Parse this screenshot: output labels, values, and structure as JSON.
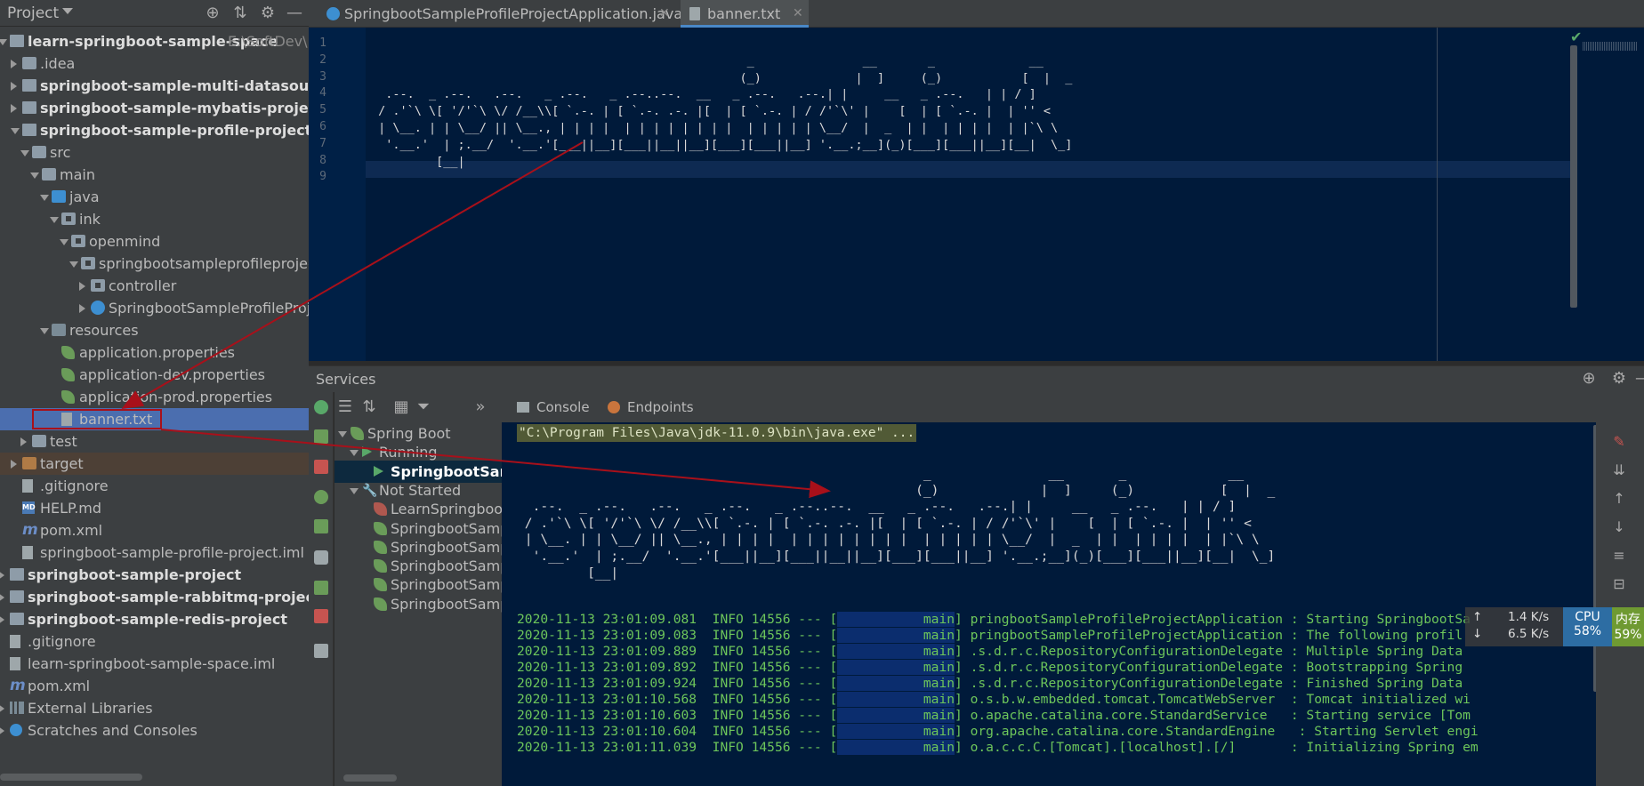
{
  "project": {
    "title": "Project",
    "tree": [
      {
        "label": "learn-springboot-sample-space",
        "path": "E:\\SoftDev\\",
        "bold": true,
        "depth": 0,
        "expand": "down",
        "icon": "module"
      },
      {
        "label": ".idea",
        "depth": 1,
        "expand": "right",
        "icon": "folder"
      },
      {
        "label": "springboot-sample-multi-datasource-project",
        "bold": true,
        "depth": 1,
        "expand": "right",
        "icon": "module"
      },
      {
        "label": "springboot-sample-mybatis-project",
        "bold": true,
        "depth": 1,
        "expand": "right",
        "icon": "module"
      },
      {
        "label": "springboot-sample-profile-project",
        "bold": true,
        "depth": 1,
        "expand": "down",
        "icon": "module"
      },
      {
        "label": "src",
        "depth": 2,
        "expand": "down",
        "icon": "folder"
      },
      {
        "label": "main",
        "depth": 3,
        "expand": "down",
        "icon": "folder"
      },
      {
        "label": "java",
        "depth": 4,
        "expand": "down",
        "icon": "folder-blue"
      },
      {
        "label": "ink",
        "depth": 5,
        "expand": "down",
        "icon": "folder-pkg"
      },
      {
        "label": "openmind",
        "depth": 6,
        "expand": "down",
        "icon": "folder-pkg"
      },
      {
        "label": "springbootsampleprofileproject",
        "depth": 7,
        "expand": "down",
        "icon": "folder-pkg"
      },
      {
        "label": "controller",
        "depth": 8,
        "expand": "right",
        "icon": "folder-pkg"
      },
      {
        "label": "SpringbootSampleProfileProjectApplication",
        "depth": 8,
        "expand": "right",
        "icon": "cls"
      },
      {
        "label": "resources",
        "depth": 4,
        "expand": "down",
        "icon": "folder-res"
      },
      {
        "label": "application.properties",
        "depth": 5,
        "icon": "leaf"
      },
      {
        "label": "application-dev.properties",
        "depth": 5,
        "icon": "leaf"
      },
      {
        "label": "application-prod.properties",
        "depth": 5,
        "icon": "leaf"
      },
      {
        "label": "banner.txt",
        "depth": 5,
        "icon": "file",
        "selected": true
      },
      {
        "label": "test",
        "depth": 2,
        "expand": "right",
        "icon": "folder"
      },
      {
        "label": "target",
        "depth": 1,
        "expand": "right",
        "icon": "folder-target",
        "target": true
      },
      {
        "label": ".gitignore",
        "depth": 1,
        "icon": "file"
      },
      {
        "label": "HELP.md",
        "depth": 1,
        "icon": "md"
      },
      {
        "label": "pom.xml",
        "depth": 1,
        "icon": "m"
      },
      {
        "label": "springboot-sample-profile-project.iml",
        "depth": 1,
        "icon": "iml"
      },
      {
        "label": "springboot-sample-project",
        "bold": true,
        "depth": 0,
        "expand": "right",
        "icon": "module"
      },
      {
        "label": "springboot-sample-rabbitmq-project",
        "bold": true,
        "depth": 0,
        "expand": "right",
        "icon": "module"
      },
      {
        "label": "springboot-sample-redis-project",
        "bold": true,
        "depth": 0,
        "expand": "right",
        "icon": "module"
      },
      {
        "label": ".gitignore",
        "depth": 0,
        "icon": "file"
      },
      {
        "label": "learn-springboot-sample-space.iml",
        "depth": 0,
        "icon": "iml"
      },
      {
        "label": "pom.xml",
        "depth": 0,
        "icon": "m"
      },
      {
        "label": "External Libraries",
        "depth": 0,
        "expand": "right",
        "icon": "libs"
      },
      {
        "label": "Scratches and Consoles",
        "depth": 0,
        "expand": "right",
        "icon": "scratch"
      }
    ]
  },
  "editor": {
    "tabs": [
      {
        "label": "SpringbootSampleProfileProjectApplication.java",
        "active": false,
        "icon": "class-icon"
      },
      {
        "label": "banner.txt",
        "active": true,
        "icon": "text-file-icon"
      }
    ],
    "line_numbers": [
      "1",
      "2",
      "3",
      "4",
      "5",
      "6",
      "7",
      "8",
      "9"
    ],
    "banner_lines": [
      "",
      "                                                    _               __       _             __",
      "                                                   (_)             |  ]     (_)           [  |  _",
      "  .--.  _ .--.   .--.   _ .--.   _ .--..--.  __   _ .--.   .--.| |     __   _ .--.   | | / ]",
      " / .'`\\ \\[ '/'`\\ \\/ /__\\\\[ `.-. | [ `.-. .-. |[  | [ `.-. | / /'`\\' |    [  | [ `.-. |  | '' <",
      " | \\__. | | \\__/ || \\__., | | | |  | | | | | | | |  | | | | | \\__/  |  _  | |  | | | |  | |`\\ \\",
      "  '.__.'  | ;.__/  '.__.'[___||__][___||__||__][___][___||__] '.__.;__](_)[___][___||__][__|  \\_]",
      "         [__|",
      ""
    ]
  },
  "services": {
    "title": "Services",
    "tree": [
      {
        "label": "Spring Boot",
        "depth": 0,
        "icon": "spring-icon"
      },
      {
        "label": "Running",
        "depth": 1,
        "icon": "run-icon"
      },
      {
        "label": "SpringbootSam",
        "depth": 2,
        "icon": "run-icon",
        "selected": true
      },
      {
        "label": "Not Started",
        "depth": 1,
        "icon": "wrench-icon"
      },
      {
        "label": "LearnSpringboo",
        "depth": 2,
        "icon": "spring-error-icon"
      },
      {
        "label": "SpringbootSamp",
        "depth": 2,
        "icon": "spring-icon"
      },
      {
        "label": "SpringbootSamp",
        "depth": 2,
        "icon": "spring-icon"
      },
      {
        "label": "SpringbootSamp",
        "depth": 2,
        "icon": "spring-icon"
      },
      {
        "label": "SpringbootSamp",
        "depth": 2,
        "icon": "spring-icon"
      },
      {
        "label": "SpringbootSamp",
        "depth": 2,
        "icon": "spring-icon"
      }
    ],
    "console_tabs": [
      {
        "label": "Console",
        "icon": "console-icon"
      },
      {
        "label": "Endpoints",
        "icon": "endpoints-icon"
      }
    ],
    "command_line": "\"C:\\Program Files\\Java\\jdk-11.0.9\\bin\\java.exe\" ...",
    "log_lines": [
      {
        "ts": "2020-11-13 23:01:09.081",
        "level": "INFO",
        "pid": "14556",
        "thread": "main",
        "logger": "pringbootSampleProfileProjectApplication",
        "msg": "Starting SpringbootSa"
      },
      {
        "ts": "2020-11-13 23:01:09.083",
        "level": "INFO",
        "pid": "14556",
        "thread": "main",
        "logger": "pringbootSampleProfileProjectApplication",
        "msg": "The following profil"
      },
      {
        "ts": "2020-11-13 23:01:09.889",
        "level": "INFO",
        "pid": "14556",
        "thread": "main",
        "logger": ".s.d.r.c.RepositoryConfigurationDelegate",
        "msg": "Multiple Spring Data"
      },
      {
        "ts": "2020-11-13 23:01:09.892",
        "level": "INFO",
        "pid": "14556",
        "thread": "main",
        "logger": ".s.d.r.c.RepositoryConfigurationDelegate",
        "msg": "Bootstrapping Spring"
      },
      {
        "ts": "2020-11-13 23:01:09.924",
        "level": "INFO",
        "pid": "14556",
        "thread": "main",
        "logger": ".s.d.r.c.RepositoryConfigurationDelegate",
        "msg": "Finished Spring Data"
      },
      {
        "ts": "2020-11-13 23:01:10.568",
        "level": "INFO",
        "pid": "14556",
        "thread": "main",
        "logger": "o.s.b.w.embedded.tomcat.TomcatWebServer ",
        "msg": "Tomcat initialized wi"
      },
      {
        "ts": "2020-11-13 23:01:10.603",
        "level": "INFO",
        "pid": "14556",
        "thread": "main",
        "logger": "o.apache.catalina.core.StandardService  ",
        "msg": "Starting service [Tom"
      },
      {
        "ts": "2020-11-13 23:01:10.604",
        "level": "INFO",
        "pid": "14556",
        "thread": "main",
        "logger": "org.apache.catalina.core.StandardEngine  ",
        "msg": "Starting Servlet engi"
      },
      {
        "ts": "2020-11-13 23:01:11.039",
        "level": "INFO",
        "pid": "14556",
        "thread": "main",
        "logger": "o.a.c.c.C.[Tomcat].[localhost].[/]      ",
        "msg": "Initializing Spring em"
      }
    ]
  },
  "widget": {
    "up_speed": "1.4 K/s",
    "down_speed": "6.5 K/s",
    "cpu_label": "CPU",
    "cpu_value": "58%",
    "mem_label": "内存",
    "mem_value": "59%"
  },
  "colors": {
    "annotation": "#a8101a",
    "selection": "#4b6eaf",
    "editor_bg": "#001a3a",
    "log_green": "#6dc65b"
  }
}
